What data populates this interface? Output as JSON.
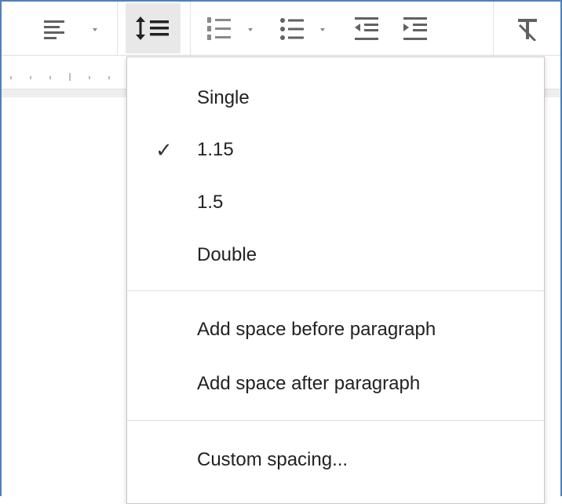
{
  "toolbar": {
    "buttons": [
      {
        "name": "align-icon",
        "has_dropdown": true
      },
      {
        "name": "line-spacing-icon",
        "has_dropdown": false,
        "active": true
      },
      {
        "name": "numbered-list-icon",
        "has_dropdown": true
      },
      {
        "name": "bulleted-list-icon",
        "has_dropdown": true
      },
      {
        "name": "decrease-indent-icon",
        "has_dropdown": false
      },
      {
        "name": "increase-indent-icon",
        "has_dropdown": false
      },
      {
        "name": "clear-formatting-icon",
        "has_dropdown": false
      }
    ]
  },
  "menu": {
    "spacing_options": [
      {
        "label": "Single",
        "checked": false
      },
      {
        "label": "1.15",
        "checked": true
      },
      {
        "label": "1.5",
        "checked": false
      },
      {
        "label": "Double",
        "checked": false
      }
    ],
    "paragraph_options": [
      {
        "label": "Add space before paragraph"
      },
      {
        "label": "Add space after paragraph"
      }
    ],
    "custom_label": "Custom spacing...",
    "check_glyph": "✓"
  },
  "colors": {
    "frame_border": "#4f81bd",
    "icon": "#616161",
    "active_bg": "#e8e8e8",
    "menu_text": "#222222"
  }
}
